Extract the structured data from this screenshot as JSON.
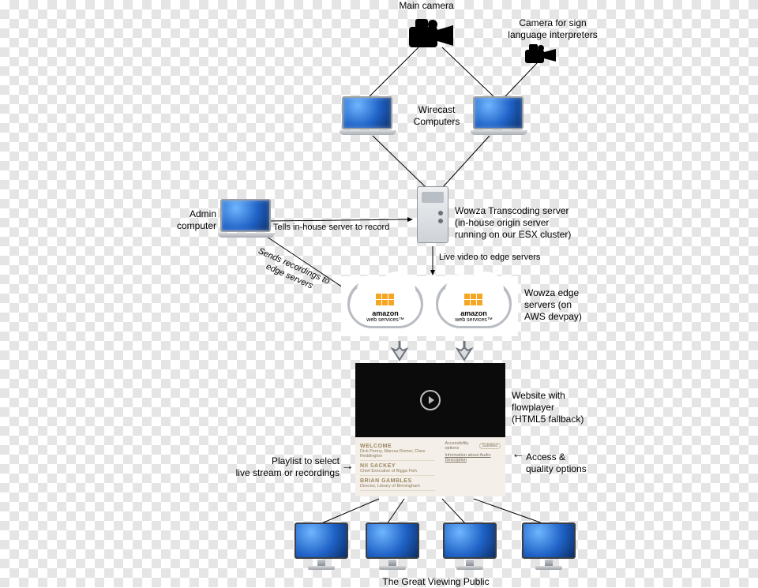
{
  "labels": {
    "main_camera": "Main camera",
    "sign_camera": "Camera for sign\nlanguage interpreters",
    "wirecast": "Wirecast\nComputers",
    "admin": "Admin\ncomputer",
    "tells_record": "Tells in-house server to record",
    "wowza_origin": "Wowza Transcoding server\n(in-house origin server\nrunning on our ESX cluster)",
    "sends_recordings": "Sends recordings to\nedge servers",
    "live_to_edge": "Live video to edge servers",
    "edge_servers": "Wowza edge\nservers (on\nAWS devpay)",
    "website": "Website with\nflowplayer\n(HTML5 fallback)",
    "playlist": "Playlist to select\nlive stream or recordings",
    "access_quality": "Access &\nquality options",
    "public": "The Great Viewing Public"
  },
  "aws": {
    "brand": "amazon",
    "sub": "web services™"
  },
  "site": {
    "playlist": [
      {
        "title": "WELCOME",
        "sub": "Dick Penny, Marcus Romer, Clare Reddington"
      },
      {
        "title": "NII SACKEY",
        "sub": "Chief Executive of Bigga Fish"
      },
      {
        "title": "BRIAN GAMBLES",
        "sub": "Director, Library of Birmingham"
      }
    ],
    "accessibility_label": "Accessibility options",
    "subtitles_pill": "Subtitled",
    "audio_desc": "Information about Audio Description"
  },
  "arrows": {
    "right": "→",
    "left": "←"
  }
}
